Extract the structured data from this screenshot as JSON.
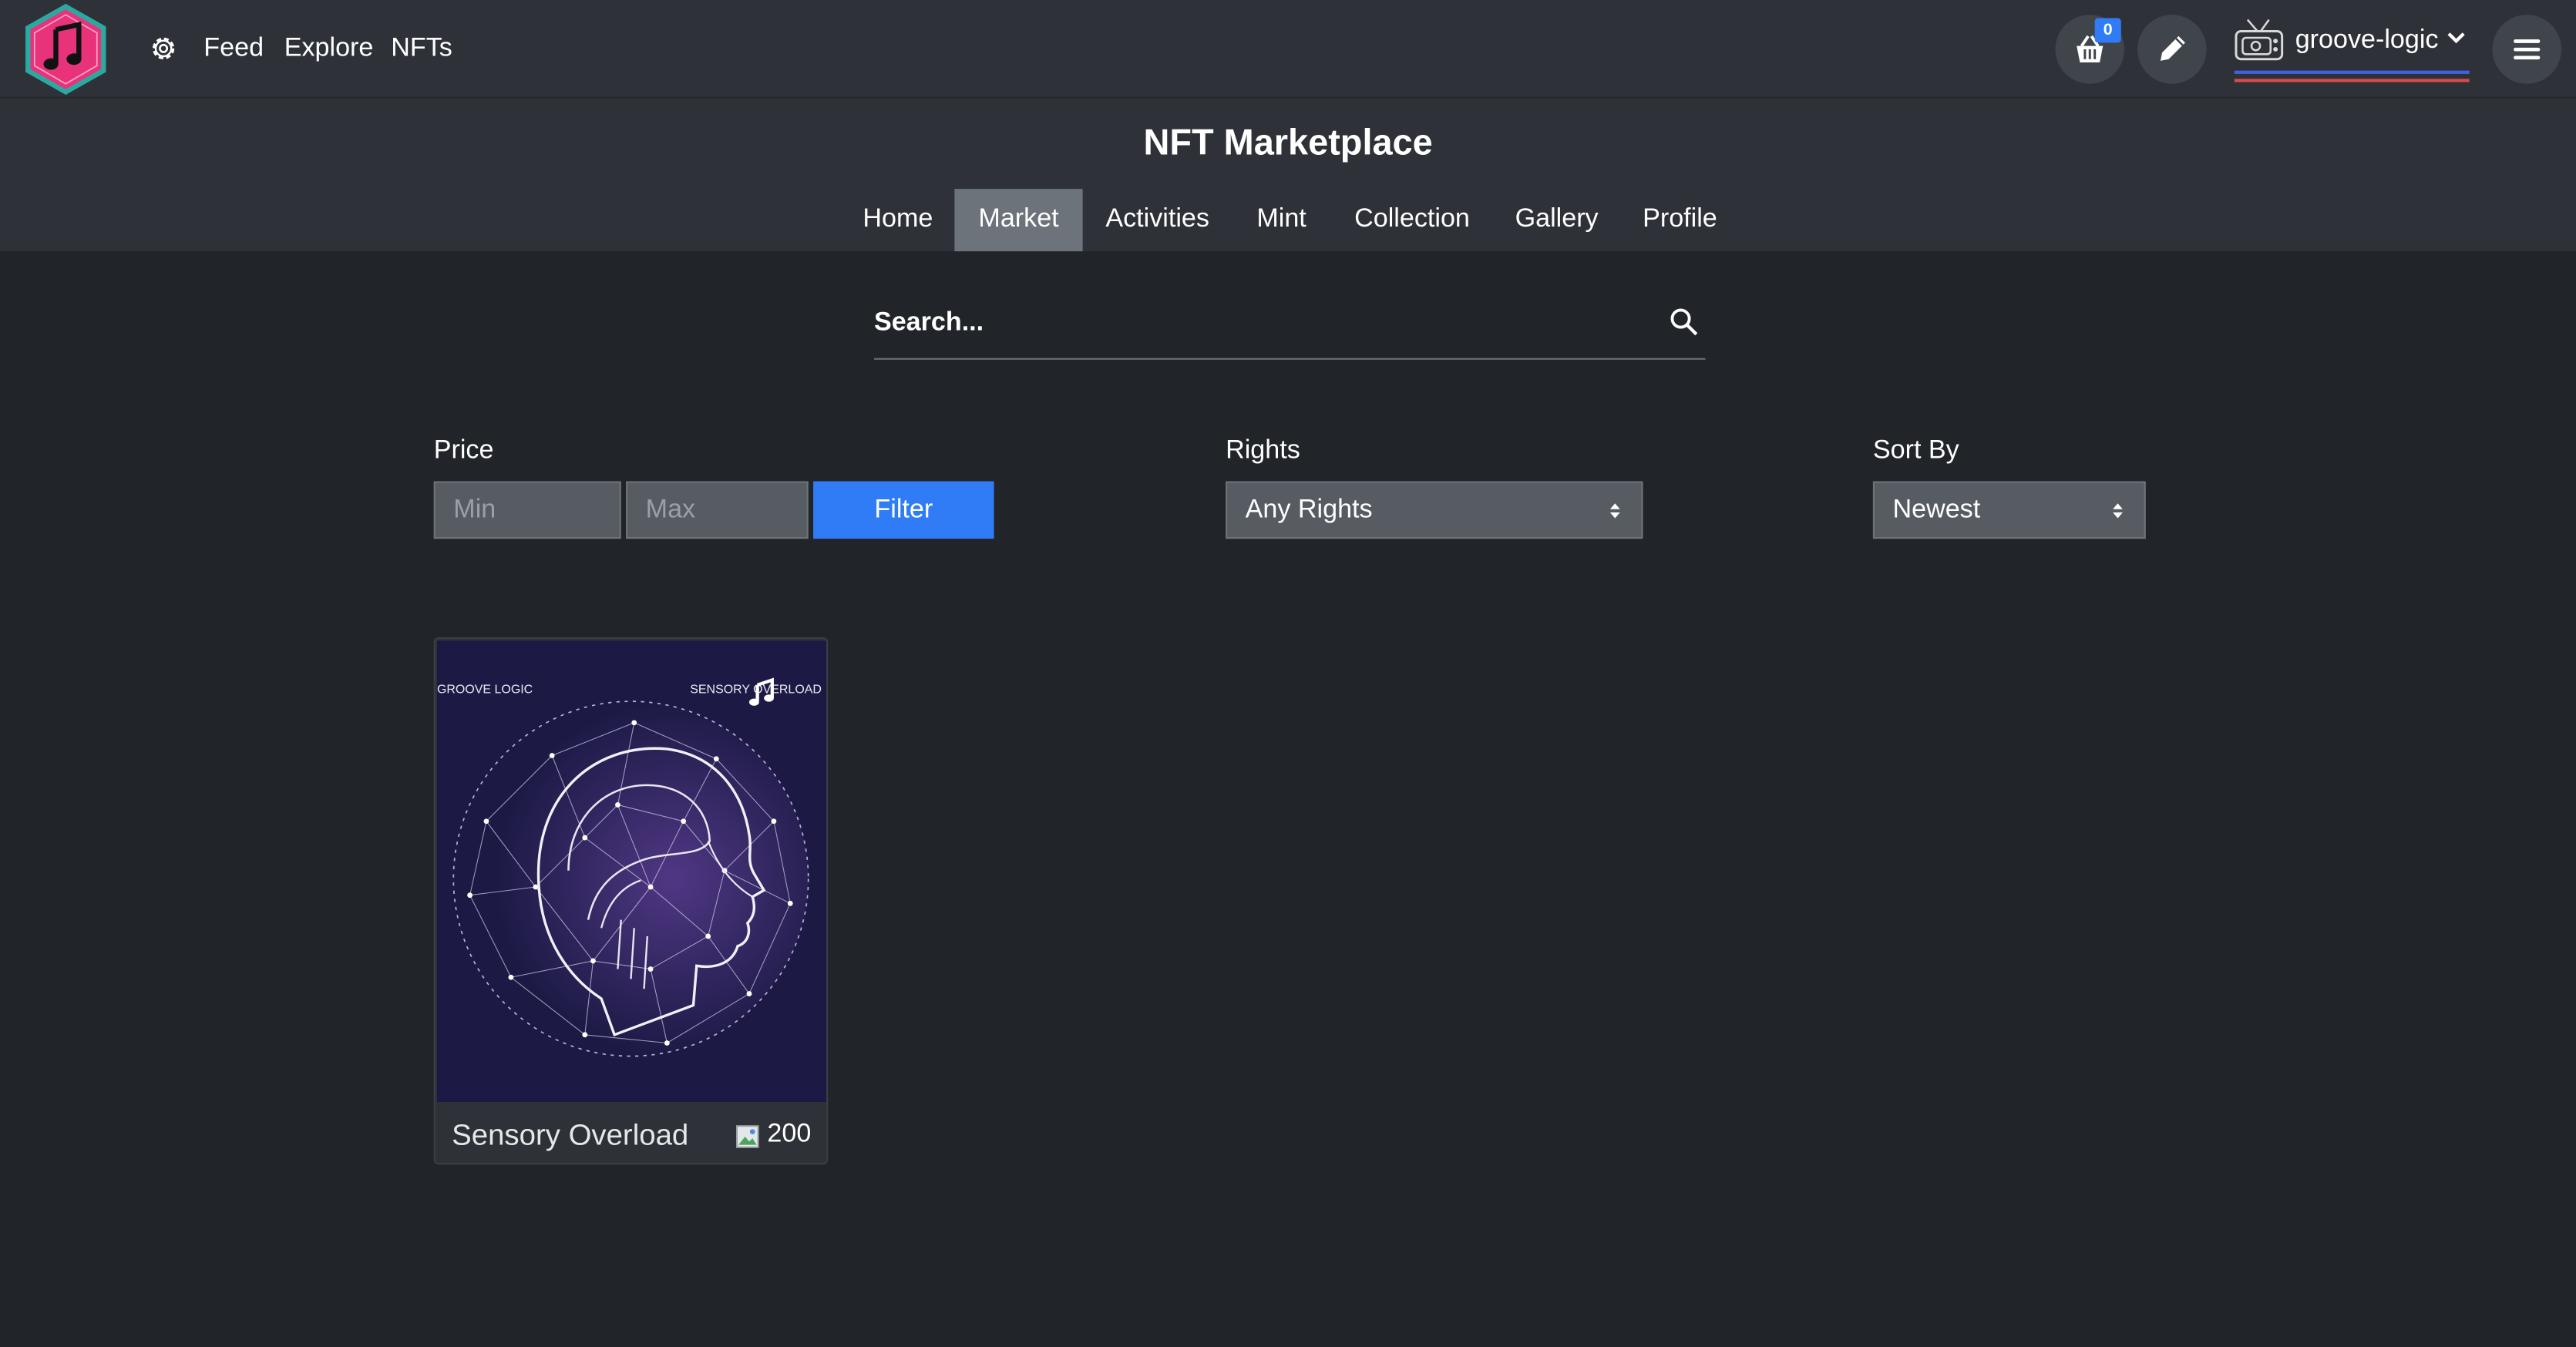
{
  "topnav": {
    "links": [
      "Feed",
      "Explore",
      "NFTs"
    ],
    "cart_count": "0",
    "username": "groove-logic"
  },
  "header": {
    "title": "NFT Marketplace",
    "tabs": [
      {
        "label": "Home"
      },
      {
        "label": "Market",
        "active": true
      },
      {
        "label": "Activities"
      },
      {
        "label": "Mint"
      },
      {
        "label": "Collection"
      },
      {
        "label": "Gallery"
      },
      {
        "label": "Profile"
      }
    ]
  },
  "search": {
    "placeholder": "Search..."
  },
  "filters": {
    "price_label": "Price",
    "min_placeholder": "Min",
    "max_placeholder": "Max",
    "filter_button": "Filter",
    "rights_label": "Rights",
    "rights_value": "Any Rights",
    "sort_label": "Sort By",
    "sort_value": "Newest"
  },
  "cards": [
    {
      "title": "Sensory Overload",
      "price": "200",
      "art_text_left": "GROOVE LOGIC",
      "art_text_right": "SENSORY OVERLOAD"
    }
  ],
  "colors": {
    "background": "#212428",
    "panel": "#2e3238",
    "accent": "#2f7cf6",
    "logo_pink": "#e8337a",
    "logo_teal": "#2aa9a0"
  },
  "icons": [
    "music-note-logo-icon",
    "gear-icon",
    "basket-icon",
    "pencil-icon",
    "chevron-down-icon",
    "hamburger-menu-icon",
    "search-icon",
    "sort-arrows-icon",
    "broken-image-icon"
  ]
}
